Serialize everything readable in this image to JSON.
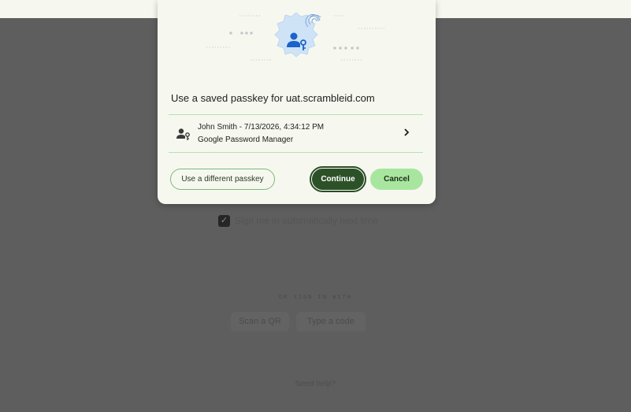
{
  "background": {
    "checkbox_label": "Sign me in automatically next time",
    "checkbox_checked": true,
    "or_sign_in": "OR SIGN IN WITH",
    "scan_qr_label": "Scan a QR",
    "type_code_label": "Type a code",
    "need_help": "Need help?"
  },
  "dialog": {
    "title": "Use a saved passkey for uat.scrambleid.com",
    "account": {
      "name_line": "John Smith - 7/13/2026, 4:34:12 PM",
      "provider": "Google Password Manager",
      "icon": "person-key-icon"
    },
    "buttons": {
      "different_passkey": "Use a different passkey",
      "continue": "Continue",
      "cancel": "Cancel"
    }
  },
  "colors": {
    "dialog_bg": "#f6f8ef",
    "primary": "#2c5128",
    "secondary": "#a8e6a0",
    "divider": "#b9dfb0",
    "badge": "#cfe3f7",
    "accent_blue": "#1a63c9",
    "overlay": "#5e5e5e"
  }
}
